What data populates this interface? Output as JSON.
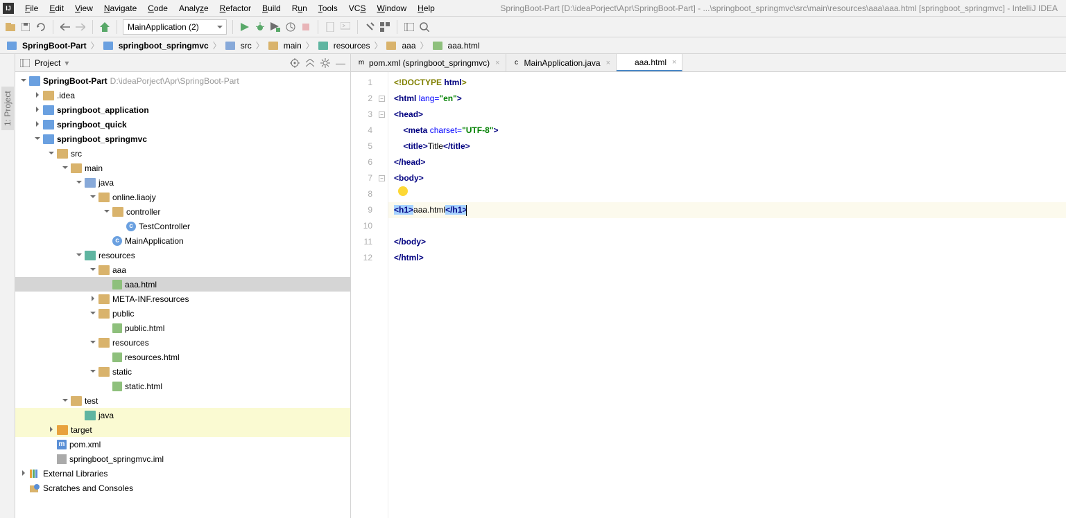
{
  "menu": {
    "items": [
      "File",
      "Edit",
      "View",
      "Navigate",
      "Code",
      "Analyze",
      "Refactor",
      "Build",
      "Run",
      "Tools",
      "VCS",
      "Window",
      "Help"
    ]
  },
  "window_title": "SpringBoot-Part [D:\\ideaPorject\\Apr\\SpringBoot-Part] - ...\\springboot_springmvc\\src\\main\\resources\\aaa\\aaa.html [springboot_springmvc] - IntelliJ IDEA",
  "run_config": "MainApplication (2)",
  "breadcrumbs": [
    "SpringBoot-Part",
    "springboot_springmvc",
    "src",
    "main",
    "resources",
    "aaa",
    "aaa.html"
  ],
  "sidebar_tab": "1: Project",
  "project_header": "Project",
  "tree": {
    "root": "SpringBoot-Part",
    "root_path": "D:\\ideaPorject\\Apr\\SpringBoot-Part",
    "n_idea": ".idea",
    "n_app": "springboot_application",
    "n_quick": "springboot_quick",
    "n_mvc": "springboot_springmvc",
    "n_src": "src",
    "n_main": "main",
    "n_java": "java",
    "n_pkg": "online.liaojy",
    "n_ctrl": "controller",
    "n_tc": "TestController",
    "n_mainapp": "MainApplication",
    "n_res": "resources",
    "n_aaa": "aaa",
    "n_aaahtml": "aaa.html",
    "n_meta": "META-INF.resources",
    "n_public": "public",
    "n_publichtml": "public.html",
    "n_resfolder": "resources",
    "n_reshtml": "resources.html",
    "n_static": "static",
    "n_statichtml": "static.html",
    "n_test": "test",
    "n_testjava": "java",
    "n_target": "target",
    "n_pom": "pom.xml",
    "n_iml": "springboot_springmvc.iml",
    "n_ext": "External Libraries",
    "n_scratch": "Scratches and Consoles"
  },
  "tabs": [
    {
      "label": "pom.xml (springboot_springmvc)",
      "icon": "m"
    },
    {
      "label": "MainApplication.java",
      "icon": "c"
    },
    {
      "label": "aaa.html",
      "icon": "h"
    }
  ],
  "code": {
    "l1_a": "<!",
    "l1_b": "DOCTYPE ",
    "l1_c": "html",
    "l1_d": ">",
    "l2_a": "<",
    "l2_b": "html ",
    "l2_c": "lang=",
    "l2_d": "\"en\"",
    "l2_e": ">",
    "l3_a": "<",
    "l3_b": "head",
    "l3_c": ">",
    "l4_a": "    <",
    "l4_b": "meta ",
    "l4_c": "charset=",
    "l4_d": "\"UTF-8\"",
    "l4_e": ">",
    "l5_a": "    <",
    "l5_b": "title",
    "l5_c": ">",
    "l5_d": "Title",
    "l5_e": "</",
    "l5_f": "title",
    "l5_g": ">",
    "l6_a": "</",
    "l6_b": "head",
    "l6_c": ">",
    "l7_a": "<",
    "l7_b": "body",
    "l7_c": ">",
    "l9_a": "<",
    "l9_b": "h1",
    "l9_c": ">",
    "l9_d": "aaa.html",
    "l9_e": "</",
    "l9_f": "h1",
    "l9_g": ">",
    "l11_a": "</",
    "l11_b": "body",
    "l11_c": ">",
    "l12_a": "</",
    "l12_b": "html",
    "l12_c": ">"
  },
  "line_numbers": [
    "1",
    "2",
    "3",
    "4",
    "5",
    "6",
    "7",
    "8",
    "9",
    "10",
    "11",
    "12"
  ]
}
